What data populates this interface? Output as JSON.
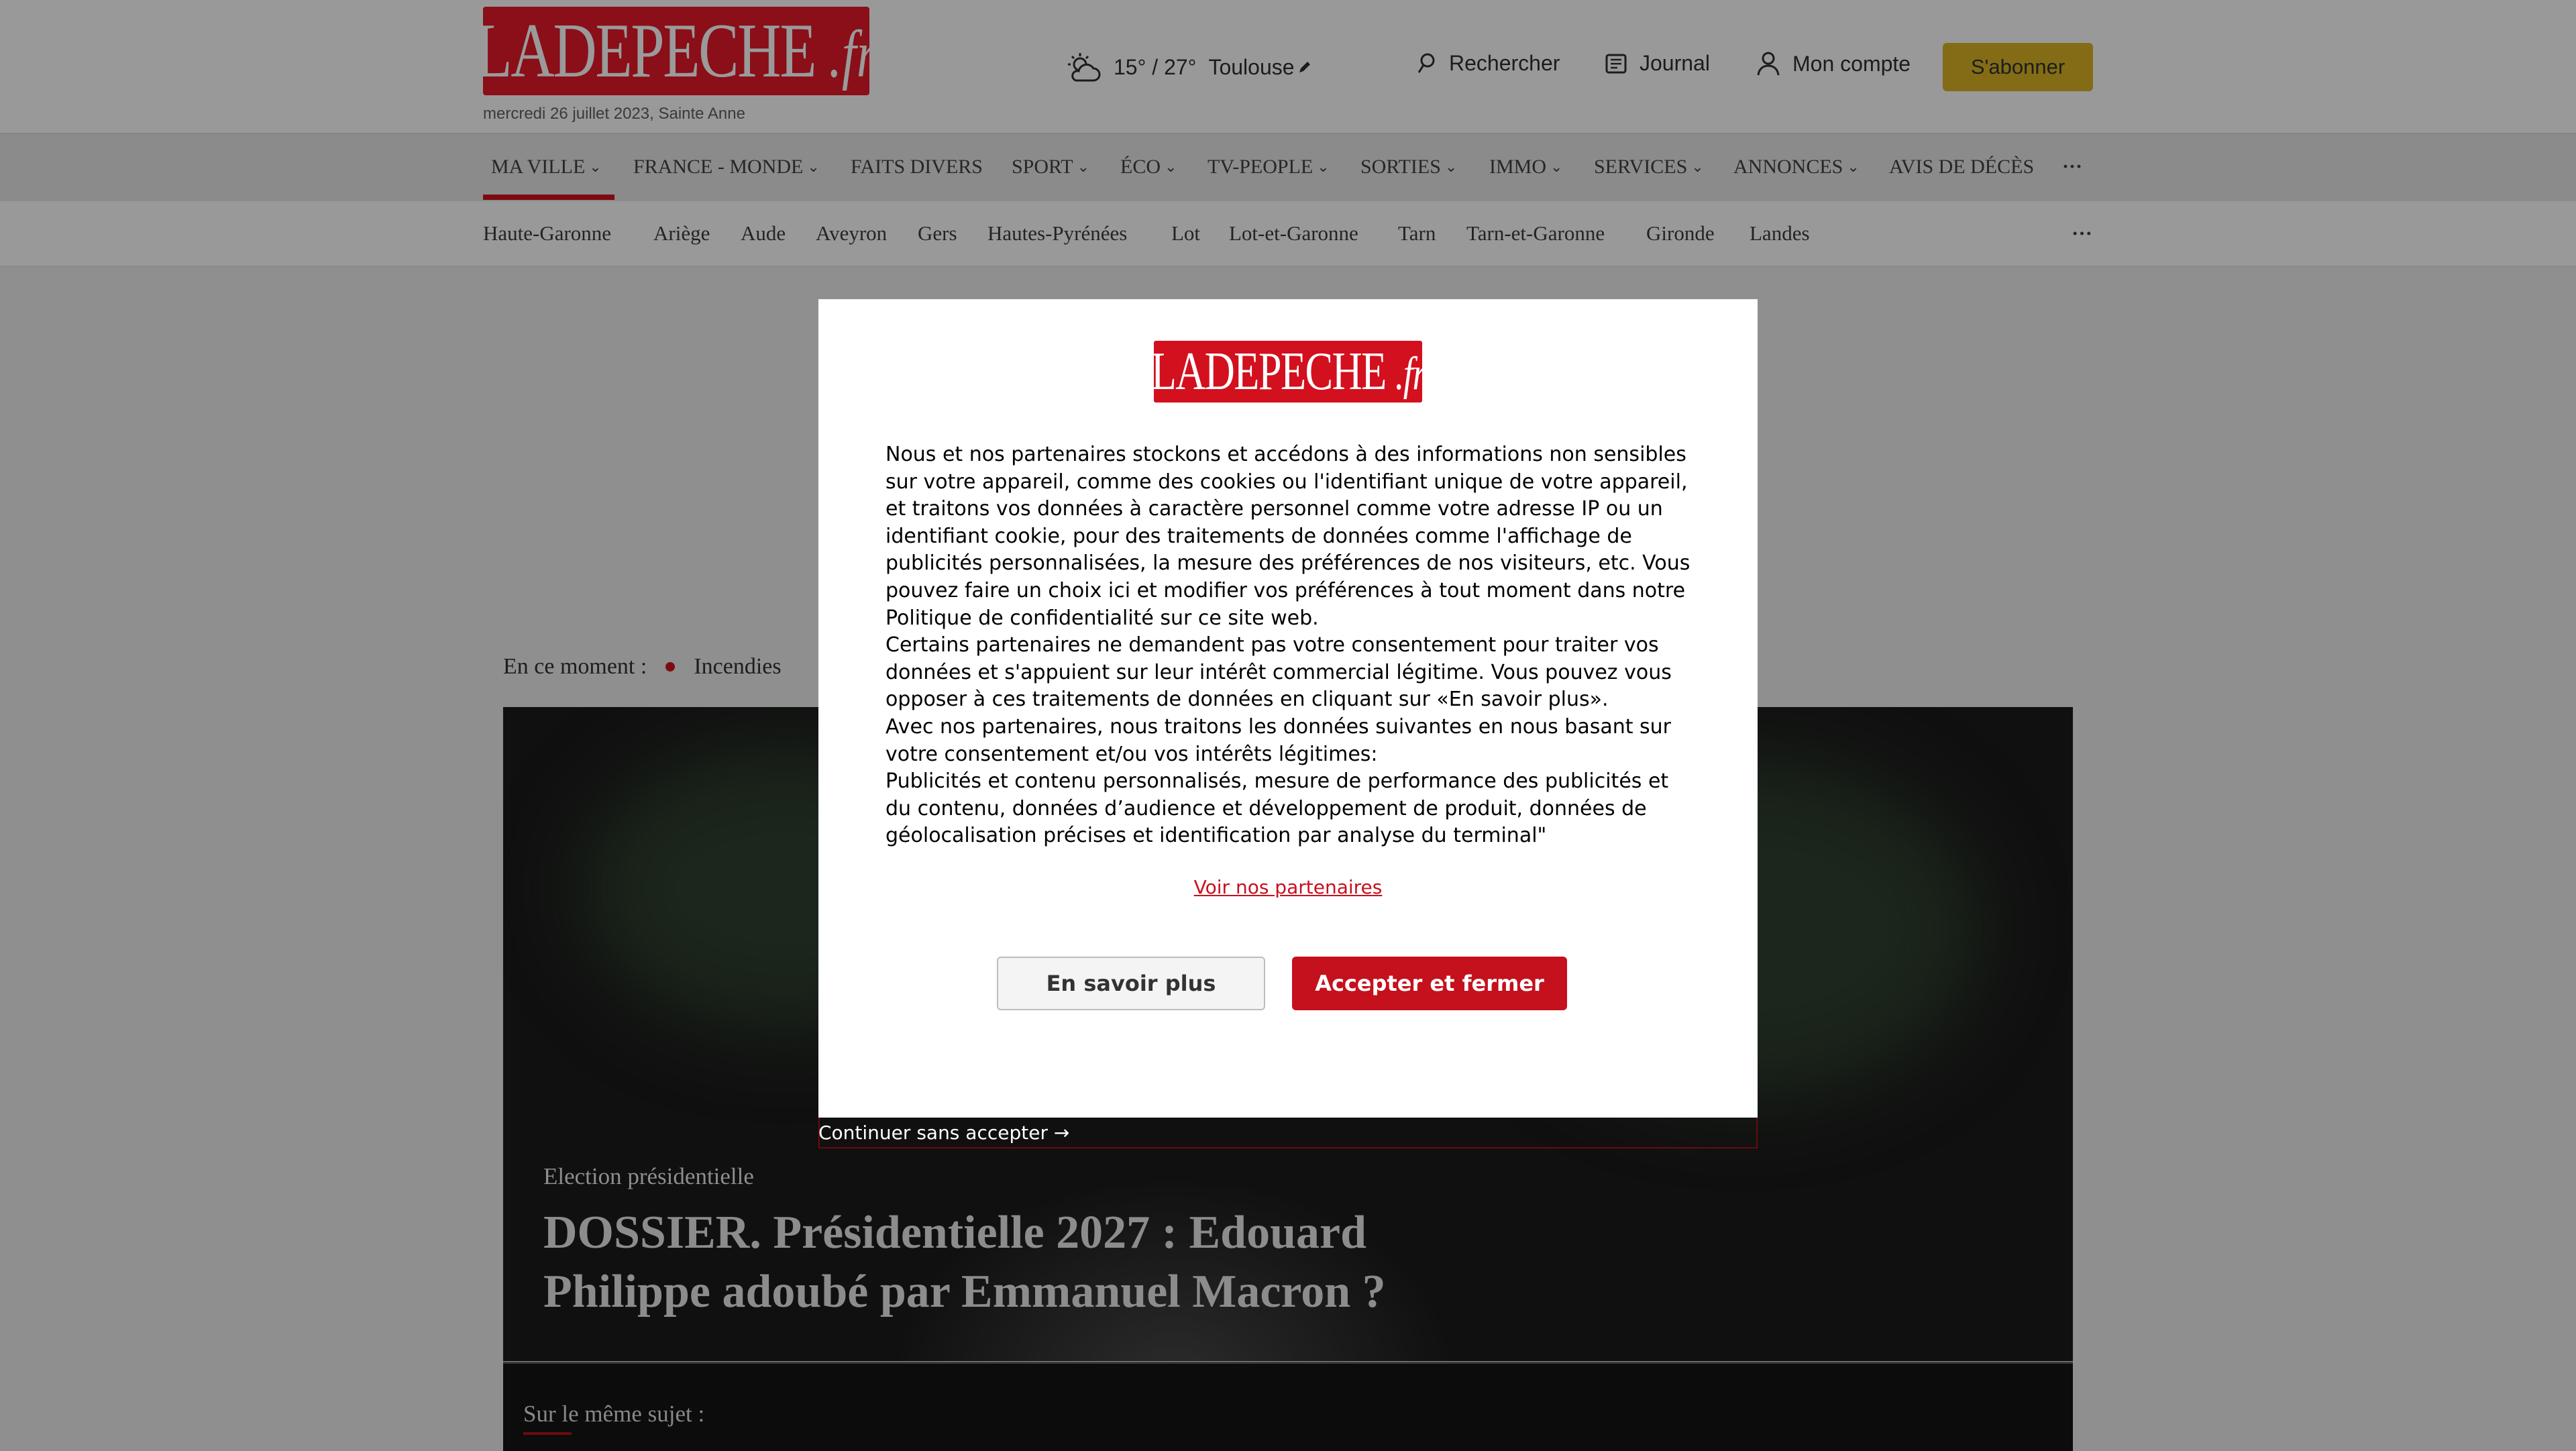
{
  "header": {
    "logo_text": "LADEPECHE",
    "logo_suffix": ".fr",
    "date_line": "mercredi 26 juillet 2023, Sainte Anne",
    "weather": {
      "icon": "partly-cloudy-icon",
      "temps": "15° / 27°",
      "city": "Toulouse",
      "edit_icon": "pencil-icon"
    },
    "search_label": "Rechercher",
    "journal_label": "Journal",
    "account_label": "Mon compte",
    "subscribe_label": "S'abonner"
  },
  "main_nav": {
    "items": [
      {
        "label": "MA VILLE",
        "has_dropdown": true,
        "active": true
      },
      {
        "label": "FRANCE - MONDE",
        "has_dropdown": true
      },
      {
        "label": "FAITS DIVERS",
        "has_dropdown": false
      },
      {
        "label": "SPORT",
        "has_dropdown": true
      },
      {
        "label": "ÉCO",
        "has_dropdown": true
      },
      {
        "label": "TV-PEOPLE",
        "has_dropdown": true
      },
      {
        "label": "SORTIES",
        "has_dropdown": true
      },
      {
        "label": "IMMO",
        "has_dropdown": true
      },
      {
        "label": "SERVICES",
        "has_dropdown": true
      },
      {
        "label": "ANNONCES",
        "has_dropdown": true
      },
      {
        "label": "AVIS DE DÉCÈS",
        "has_dropdown": false
      }
    ],
    "more_label": "···"
  },
  "sub_nav": {
    "items": [
      "Haute-Garonne",
      "Ariège",
      "Aude",
      "Aveyron",
      "Gers",
      "Hautes-Pyrénées",
      "Lot",
      "Lot-et-Garonne",
      "Tarn",
      "Tarn-et-Garonne",
      "Gironde",
      "Landes"
    ],
    "more_label": "···"
  },
  "trending": {
    "label": "En ce moment :",
    "first_item": "Incendies"
  },
  "hero": {
    "category": "Election présidentielle",
    "title": "DOSSIER. Présidentielle 2027 : Edouard Philippe adoubé par Emmanuel Macron ?"
  },
  "related": {
    "label": "Sur le même sujet :"
  },
  "consent": {
    "logo_text": "LADEPECHE",
    "logo_suffix": ".fr",
    "paragraphs": [
      "Nous et nos partenaires stockons et accédons à des informations non sensibles sur votre appareil, comme des cookies ou l'identifiant unique de votre appareil, et traitons vos données à caractère personnel comme votre adresse IP ou un identifiant cookie, pour des traitements de données comme l'affichage de publicités personnalisées, la mesure des préférences de nos visiteurs, etc. Vous pouvez faire un choix ici et modifier vos préférences à tout moment dans notre Politique de confidentialité sur ce site web.",
      "Certains partenaires ne demandent pas votre consentement pour traiter vos données et s'appuient sur leur intérêt commercial légitime. Vous pouvez vous opposer à ces traitements de données en cliquant sur «En savoir plus».",
      "Avec nos partenaires, nous traitons les données suivantes en nous basant sur votre consentement et/ou vos intérêts légitimes:",
      "Publicités et contenu personnalisés, mesure de performance des publicités et du contenu, données d’audience et développement de produit, données de géolocalisation précises et identification par analyse du terminal\""
    ],
    "partners_link": "Voir nos partenaires",
    "more_button": "En savoir plus",
    "accept_button": "Accepter et fermer",
    "continue_link": "Continuer sans accepter →"
  },
  "colors": {
    "brand_red": "#d3101e",
    "accept_red": "#c5101d",
    "subscribe_gold": "#d4af37",
    "overlay_dim": "rgba(0,0,0,0.4)"
  }
}
